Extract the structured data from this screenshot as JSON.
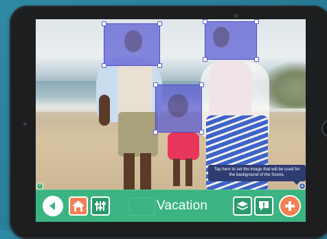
{
  "scene": {
    "title": "Vacation",
    "tooltip": "Tap here to set the image that will be used for the background of the Scene."
  },
  "icons": {
    "back": "arrow-left-icon",
    "home": "home-icon",
    "adjust": "sliders-icon",
    "layers": "layers-icon",
    "alert": "exclamation-icon",
    "add": "plus-icon"
  },
  "colors": {
    "toolbar": "#3bb482",
    "accent_orange": "#f38154",
    "selection": "#5a5ad2",
    "tooltip_bg": "#2f3c72"
  }
}
